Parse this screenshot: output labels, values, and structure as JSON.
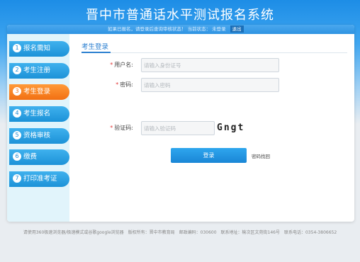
{
  "header": {
    "title": "晋中市普通话水平测试报名系统"
  },
  "status_bar": {
    "notice": "如果已报名，请登录后查询审核状态！",
    "status_label": "当前状态：",
    "status_value": "未登录",
    "logout_label": "退出"
  },
  "sidebar": {
    "items": [
      {
        "num": "1",
        "label": "报名需知"
      },
      {
        "num": "2",
        "label": "考生注册"
      },
      {
        "num": "3",
        "label": "考生登录"
      },
      {
        "num": "4",
        "label": "考生报名"
      },
      {
        "num": "5",
        "label": "资格审核"
      },
      {
        "num": "6",
        "label": "缴费"
      },
      {
        "num": "7",
        "label": "打印准考证"
      }
    ],
    "active_index": 2
  },
  "login": {
    "tab_title": "考生登录",
    "username_label": "用户名:",
    "username_placeholder": "请输入身份证号",
    "password_label": "密码:",
    "password_placeholder": "请输入密码",
    "captcha_label": "验证码:",
    "captcha_placeholder": "请输入验证码",
    "captcha_text": "Gngt",
    "login_button": "登录",
    "find_password": "密码找回"
  },
  "footer": {
    "text": "请使用360极速浏览器/极速模式或谷歌google浏览器　版权所有：晋中市教育局　邮政编码：030600　联系地址：榆次区文苑街146号　联系电话：0354-3806652"
  },
  "colors": {
    "accent": "#1d8de6",
    "active_tab": "#f26f12",
    "required": "#e23b3b"
  }
}
